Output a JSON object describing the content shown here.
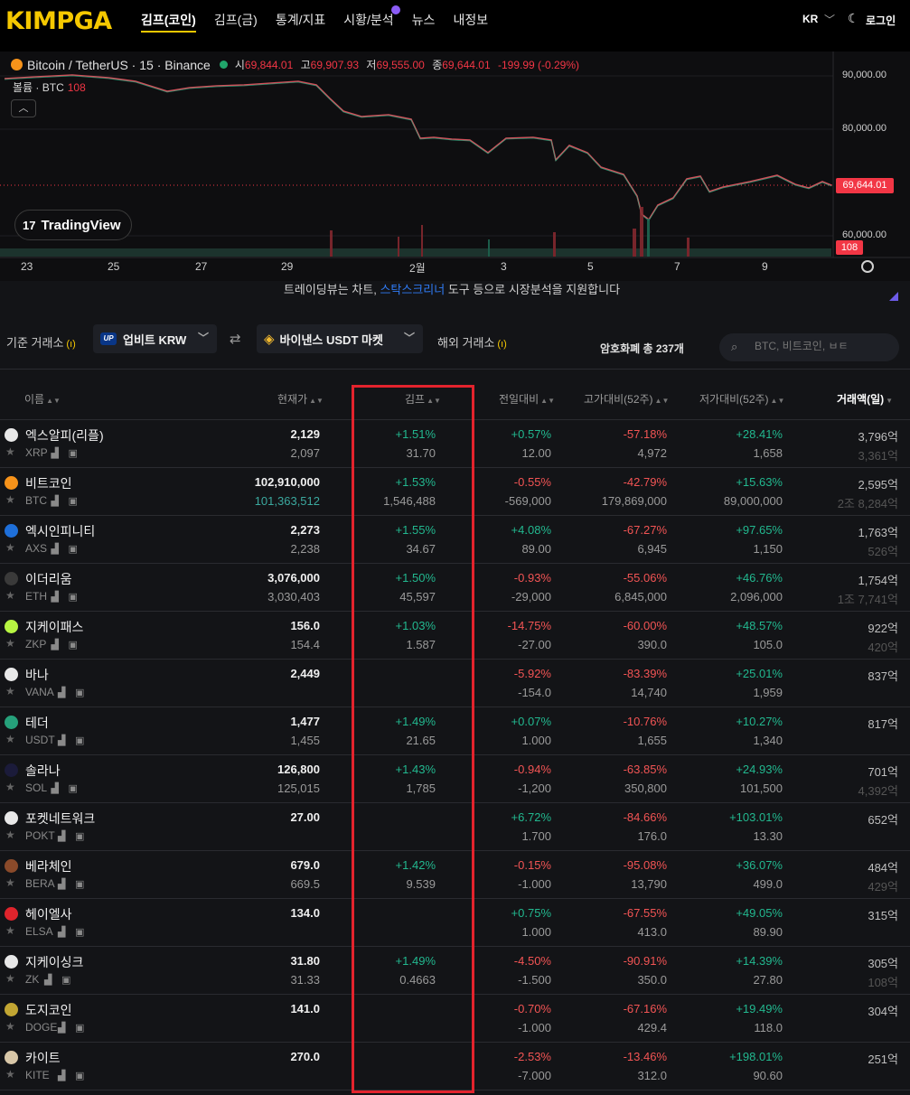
{
  "header": {
    "logo": "KIMPGA",
    "nav": [
      "김프(코인)",
      "김프(금)",
      "통계/지표",
      "시황/분석",
      "뉴스",
      "내정보"
    ],
    "lang": "KR",
    "login": "로그인"
  },
  "chart": {
    "symbol": "Bitcoin / TetherUS · 15 · Binance",
    "open_label": "시",
    "open": "69,844.01",
    "high_label": "고",
    "high": "69,907.93",
    "low_label": "저",
    "low": "69,555.00",
    "close_label": "종",
    "close": "69,644.01",
    "change": "-199.99 (-0.29%)",
    "volume_label": "볼륨 · BTC",
    "volume": "108",
    "tv_brand": "TradingView",
    "price_tag": "69,644.01",
    "vol_tag": "108",
    "y_labels": [
      "90,000.00",
      "80,000.00",
      "60,000.00"
    ],
    "x_labels": [
      "23",
      "25",
      "27",
      "29",
      "2월",
      "3",
      "5",
      "7",
      "9"
    ],
    "caption_pre": "트레이딩뷰는 차트, ",
    "caption_link": "스탁스크리너",
    "caption_post": " 도구 등으로 시장분석을 지원합니다"
  },
  "exchange": {
    "base_label": "기준 거래소",
    "base_value": "업비트 KRW",
    "foreign_value": "바이낸스 USDT 마켓",
    "foreign_label": "해외 거래소",
    "coin_count": "암호화폐 총 237개",
    "search_placeholder": "BTC, 비트코인, ㅂㅌ"
  },
  "table": {
    "headers": {
      "name": "이름",
      "price": "현재가",
      "kimp": "김프",
      "day": "전일대비",
      "high52": "고가대비(52주)",
      "low52": "저가대비(52주)",
      "volume": "거래액(일)"
    },
    "rows": [
      {
        "name": "엑스알피(리플)",
        "sym": "XRP",
        "icon_color": "#e8e8e8",
        "price": "2,129",
        "price2": "2,097",
        "kimp": "+1.51%",
        "kimp2": "31.70",
        "day": "+0.57%",
        "day2": "12.00",
        "high": "-57.18%",
        "high2": "4,972",
        "low": "+28.41%",
        "low2": "1,658",
        "vol": "3,796억",
        "vol2": "3,361억"
      },
      {
        "name": "비트코인",
        "sym": "BTC",
        "icon_color": "#f7931a",
        "price": "102,910,000",
        "price2": "101,363,512",
        "kimp": "+1.53%",
        "kimp2": "1,546,488",
        "day": "-0.55%",
        "day2": "-569,000",
        "high": "-42.79%",
        "high2": "179,869,000",
        "low": "+15.63%",
        "low2": "89,000,000",
        "vol": "2,595억",
        "vol2": "2조 8,284억"
      },
      {
        "name": "엑시인피니티",
        "sym": "AXS",
        "icon_color": "#1e6fd9",
        "price": "2,273",
        "price2": "2,238",
        "kimp": "+1.55%",
        "kimp2": "34.67",
        "day": "+4.08%",
        "day2": "89.00",
        "high": "-67.27%",
        "high2": "6,945",
        "low": "+97.65%",
        "low2": "1,150",
        "vol": "1,763억",
        "vol2": "526억"
      },
      {
        "name": "이더리움",
        "sym": "ETH",
        "icon_color": "#3a3a3a",
        "price": "3,076,000",
        "price2": "3,030,403",
        "kimp": "+1.50%",
        "kimp2": "45,597",
        "day": "-0.93%",
        "day2": "-29,000",
        "high": "-55.06%",
        "high2": "6,845,000",
        "low": "+46.76%",
        "low2": "2,096,000",
        "vol": "1,754억",
        "vol2": "1조 7,741억"
      },
      {
        "name": "지케이패스",
        "sym": "ZKP",
        "icon_color": "#b7f542",
        "price": "156.0",
        "price2": "154.4",
        "kimp": "+1.03%",
        "kimp2": "1.587",
        "day": "-14.75%",
        "day2": "-27.00",
        "high": "-60.00%",
        "high2": "390.0",
        "low": "+48.57%",
        "low2": "105.0",
        "vol": "922억",
        "vol2": "420억"
      },
      {
        "name": "바나",
        "sym": "VANA",
        "icon_color": "#e8e8e8",
        "price": "2,449",
        "price2": "",
        "kimp": "",
        "kimp2": "",
        "day": "-5.92%",
        "day2": "-154.0",
        "high": "-83.39%",
        "high2": "14,740",
        "low": "+25.01%",
        "low2": "1,959",
        "vol": "837억",
        "vol2": ""
      },
      {
        "name": "테더",
        "sym": "USDT",
        "icon_color": "#26a17b",
        "price": "1,477",
        "price2": "1,455",
        "kimp": "+1.49%",
        "kimp2": "21.65",
        "day": "+0.07%",
        "day2": "1.000",
        "high": "-10.76%",
        "high2": "1,655",
        "low": "+10.27%",
        "low2": "1,340",
        "vol": "817억",
        "vol2": ""
      },
      {
        "name": "솔라나",
        "sym": "SOL",
        "icon_color": "#1b1b3a",
        "price": "126,800",
        "price2": "125,015",
        "kimp": "+1.43%",
        "kimp2": "1,785",
        "day": "-0.94%",
        "day2": "-1,200",
        "high": "-63.85%",
        "high2": "350,800",
        "low": "+24.93%",
        "low2": "101,500",
        "vol": "701억",
        "vol2": "4,392억"
      },
      {
        "name": "포켓네트워크",
        "sym": "POKT",
        "icon_color": "#e8e8e8",
        "price": "27.00",
        "price2": "",
        "kimp": "",
        "kimp2": "",
        "day": "+6.72%",
        "day2": "1.700",
        "high": "-84.66%",
        "high2": "176.0",
        "low": "+103.01%",
        "low2": "13.30",
        "vol": "652억",
        "vol2": ""
      },
      {
        "name": "베라체인",
        "sym": "BERA",
        "icon_color": "#8a4a2a",
        "price": "679.0",
        "price2": "669.5",
        "kimp": "+1.42%",
        "kimp2": "9.539",
        "day": "-0.15%",
        "day2": "-1.000",
        "high": "-95.08%",
        "high2": "13,790",
        "low": "+36.07%",
        "low2": "499.0",
        "vol": "484억",
        "vol2": "429억"
      },
      {
        "name": "헤이엘사",
        "sym": "ELSA",
        "icon_color": "#e0242c",
        "price": "134.0",
        "price2": "",
        "kimp": "",
        "kimp2": "",
        "day": "+0.75%",
        "day2": "1.000",
        "high": "-67.55%",
        "high2": "413.0",
        "low": "+49.05%",
        "low2": "89.90",
        "vol": "315억",
        "vol2": ""
      },
      {
        "name": "지케이싱크",
        "sym": "ZK",
        "icon_color": "#e8e8e8",
        "price": "31.80",
        "price2": "31.33",
        "kimp": "+1.49%",
        "kimp2": "0.4663",
        "day": "-4.50%",
        "day2": "-1.500",
        "high": "-90.91%",
        "high2": "350.0",
        "low": "+14.39%",
        "low2": "27.80",
        "vol": "305억",
        "vol2": "108억"
      },
      {
        "name": "도지코인",
        "sym": "DOGE",
        "icon_color": "#c2a633",
        "price": "141.0",
        "price2": "",
        "kimp": "",
        "kimp2": "",
        "day": "-0.70%",
        "day2": "-1.000",
        "high": "-67.16%",
        "high2": "429.4",
        "low": "+19.49%",
        "low2": "118.0",
        "vol": "304억",
        "vol2": ""
      },
      {
        "name": "카이트",
        "sym": "KITE",
        "icon_color": "#d8c7a8",
        "price": "270.0",
        "price2": "",
        "kimp": "",
        "kimp2": "",
        "day": "-2.53%",
        "day2": "-7.000",
        "high": "-13.46%",
        "high2": "312.0",
        "low": "+198.01%",
        "low2": "90.60",
        "vol": "251억",
        "vol2": ""
      }
    ]
  }
}
